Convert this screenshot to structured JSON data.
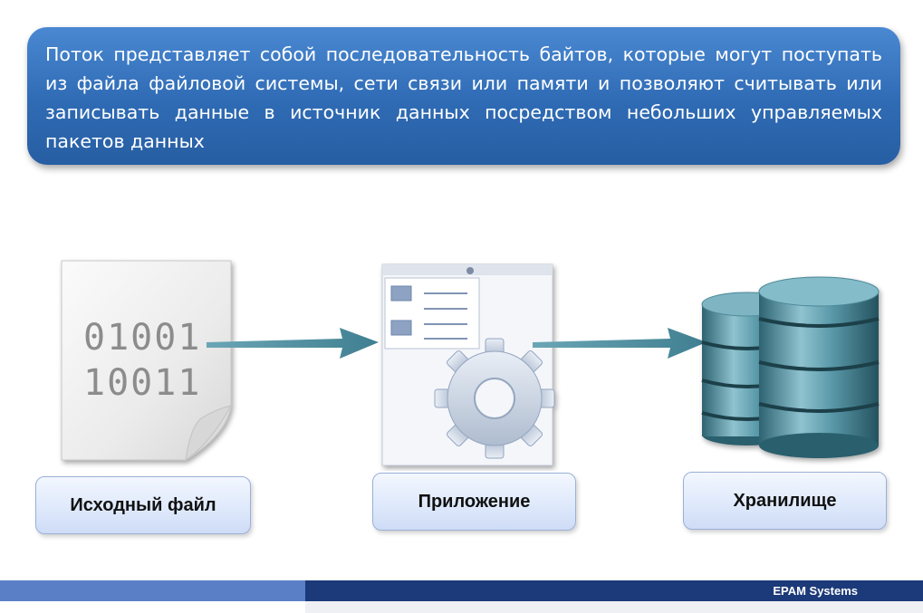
{
  "banner": {
    "text": "Поток представляет собой последовательность байтов, которые могут поступать из файла файловой системы, сети связи или памяти и позволяют считывать или записывать данные в источник данных посредством небольших управляемых пакетов данных"
  },
  "nodes": [
    {
      "label": "Исходный файл",
      "icon": "binary-file-icon",
      "file_lines": [
        "01001",
        "10011"
      ]
    },
    {
      "label": "Приложение",
      "icon": "application-gear-icon"
    },
    {
      "label": "Хранилище",
      "icon": "database-icon"
    }
  ],
  "colors": {
    "banner": "#2f6bb4",
    "arrow": "#4d8e9f",
    "database": "#4f8d9c",
    "footer_left": "#5b7fc6",
    "footer_right": "#1c3a79"
  },
  "footer": {
    "brand": "EPAM Systems"
  }
}
